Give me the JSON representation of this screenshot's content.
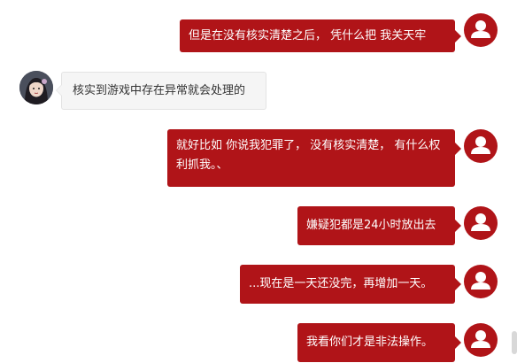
{
  "conversation": {
    "messages": [
      {
        "sender": "user",
        "text": "但是在没有核实清楚之后， 凭什么把 我关天牢"
      },
      {
        "sender": "agent",
        "text": "核实到游戏中存在异常就会处理的"
      },
      {
        "sender": "user",
        "text": "就好比如 你说我犯罪了， 没有核实清楚， 有什么权利抓我。、"
      },
      {
        "sender": "user",
        "text": "嫌疑犯都是24小时放出去"
      },
      {
        "sender": "user",
        "text": "...现在是一天还没完，再增加一天。"
      },
      {
        "sender": "user",
        "text": "我看你们才是非法操作。"
      }
    ]
  },
  "colors": {
    "user_bubble": "#b01418",
    "agent_bubble": "#f5f5f5",
    "user_text": "#ffffff",
    "agent_text": "#333333"
  },
  "icons": {
    "user_avatar": "user-silhouette-icon",
    "agent_avatar": "agent-avatar-image"
  }
}
